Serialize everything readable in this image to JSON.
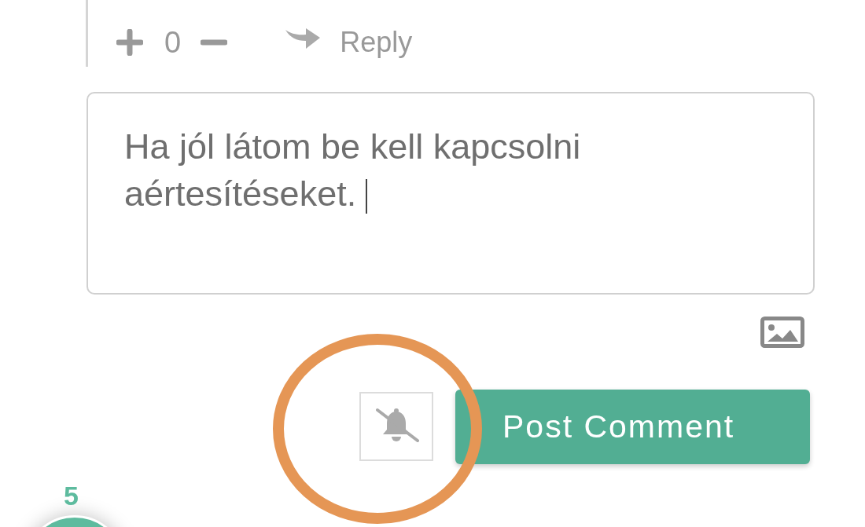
{
  "comment_actions": {
    "score": "0",
    "reply": "Reply"
  },
  "comment_field": {
    "value": "Ha jól látom be kell kapcsolni aértesítéseket.",
    "focused": true
  },
  "notifications_on": false,
  "post_button": "Post Comment",
  "annotation": {
    "kind": "ellipse",
    "color": "#e59655"
  },
  "floating_badge": {
    "count": "5"
  }
}
